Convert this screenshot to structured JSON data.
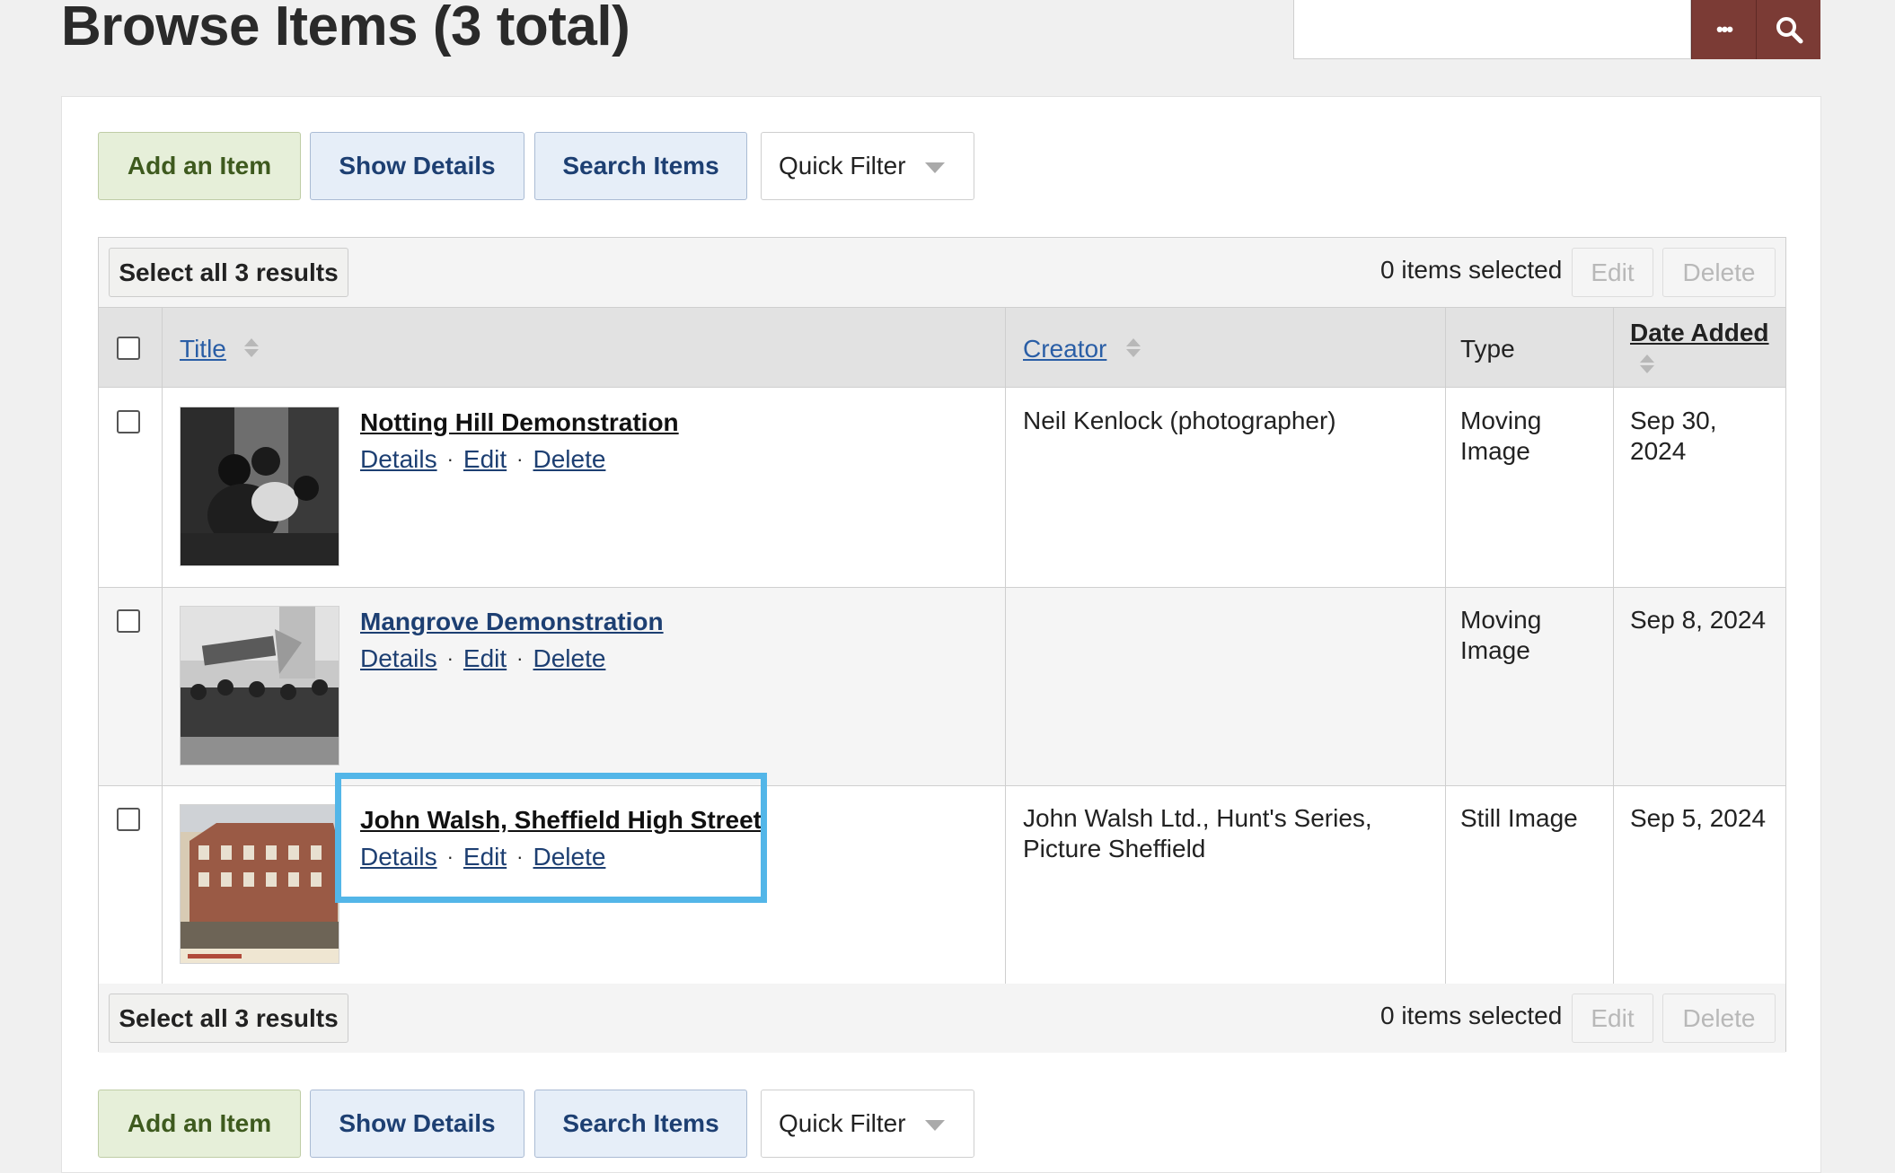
{
  "header": {
    "title": "Browse Items (3 total)",
    "search_placeholder": "",
    "options_label": "•••"
  },
  "toolbar": {
    "add_item": "Add an Item",
    "show_details": "Show Details",
    "search_items": "Search Items",
    "quick_filter": "Quick Filter"
  },
  "batch": {
    "select_all": "Select all 3 results",
    "selected_count": "0 items selected",
    "edit": "Edit",
    "delete": "Delete"
  },
  "table": {
    "columns": {
      "title": "Title",
      "creator": "Creator",
      "type": "Type",
      "date_added": "Date Added"
    },
    "rows": [
      {
        "title": "Notting Hill Demonstration",
        "details": "Details",
        "edit": "Edit",
        "delete": "Delete",
        "creator": "Neil Kenlock (photographer)",
        "type_line1": "Moving",
        "type_line2": "Image",
        "date_line1": "Sep 30,",
        "date_line2": "2024"
      },
      {
        "title": "Mangrove Demonstration",
        "details": "Details",
        "edit": "Edit",
        "delete": "Delete",
        "creator": "",
        "type_line1": "Moving",
        "type_line2": "Image",
        "date_line1": "Sep 8, 2024",
        "date_line2": ""
      },
      {
        "title": "John Walsh, Sheffield High Street",
        "details": "Details",
        "edit": "Edit",
        "delete": "Delete",
        "creator_line1": "John Walsh Ltd., Hunt's Series,",
        "creator_line2": "Picture Sheffield",
        "type_line1": "Still Image",
        "type_line2": "",
        "date_line1": "Sep 5, 2024",
        "date_line2": ""
      }
    ]
  },
  "colors": {
    "accent_dark_red": "#7b3b35",
    "highlight_blue": "#53b6e8",
    "link_blue": "#1d3f72"
  }
}
